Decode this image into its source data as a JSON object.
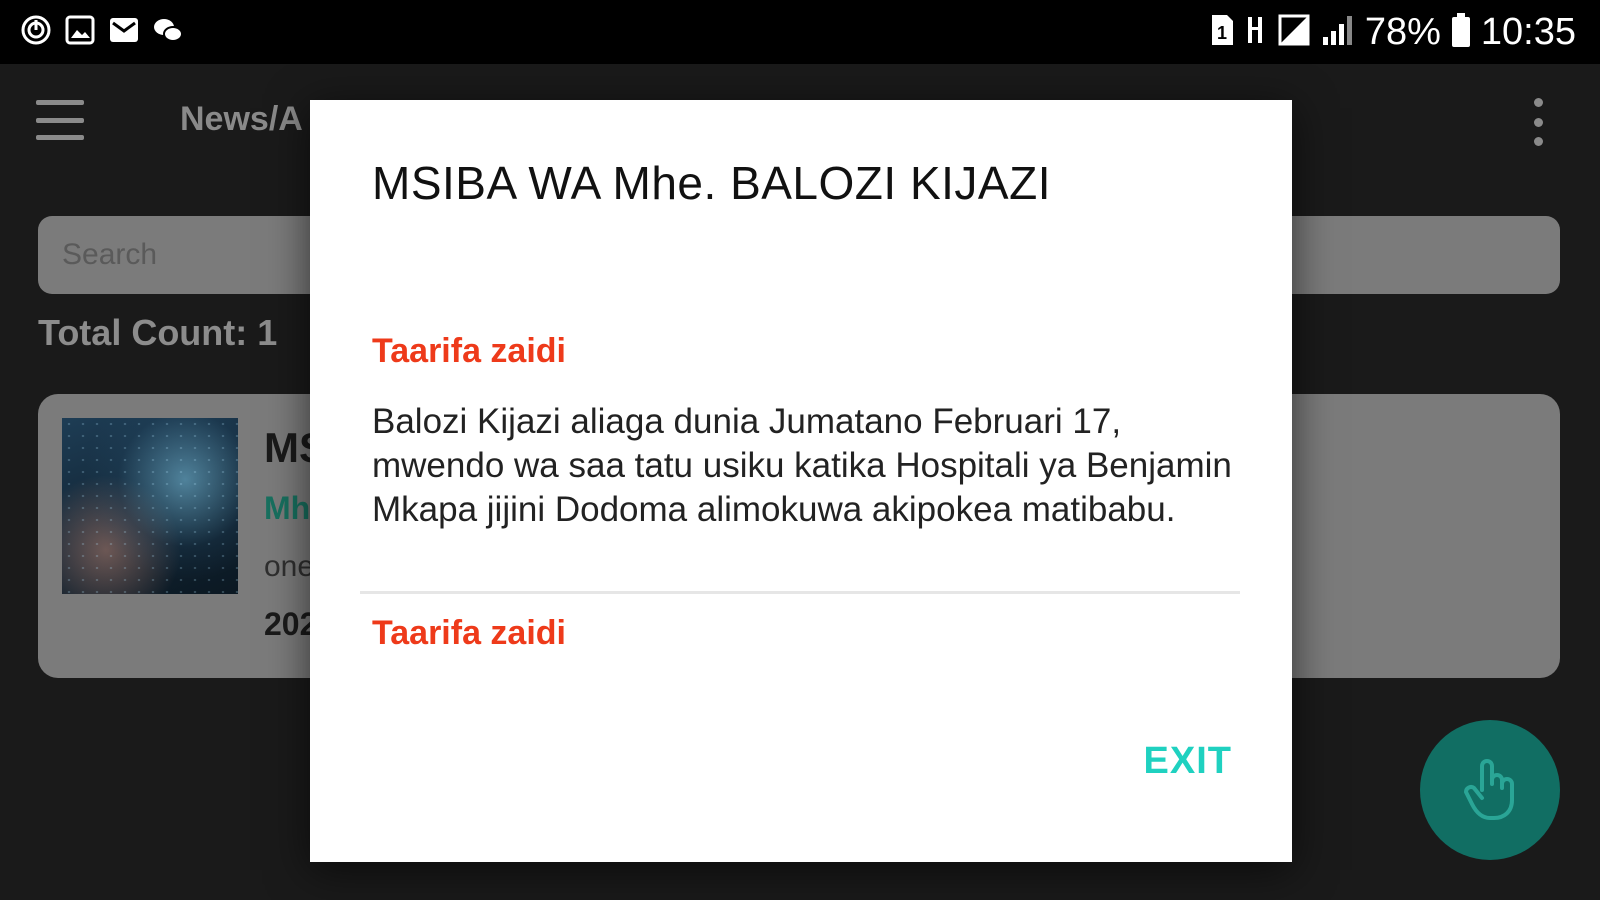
{
  "status_bar": {
    "battery_percent": "78%",
    "clock": "10:35",
    "left_icons": [
      "alarm-icon",
      "gallery-icon",
      "mail-icon",
      "chat-icon"
    ],
    "right_icons": [
      "sim-icon",
      "data-arrows-icon",
      "no-signal-icon",
      "signal-icon",
      "battery-icon"
    ]
  },
  "app_bar": {
    "title": "News/A",
    "menu_icon": "hamburger-menu-icon",
    "overflow_icon": "more-vert-icon"
  },
  "search": {
    "placeholder": "Search"
  },
  "list": {
    "total_count": "Total Count: 1",
    "items": [
      {
        "title": "MS",
        "subtitle": "Mh",
        "summary": "one",
        "date": "202"
      }
    ]
  },
  "fab": {
    "icon": "touch-hand-icon"
  },
  "dialog": {
    "title": "MSIBA WA Mhe. BALOZI KIJAZI",
    "link_top": "Taarifa zaidi",
    "body": "Balozi Kijazi aliaga dunia Jumatano Februari 17, mwendo wa saa tatu usiku katika Hospitali ya Benjamin Mkapa jijini Dodoma alimokuwa akipokea matibabu.",
    "link_bottom": "Taarifa zaidi",
    "exit_label": "EXIT"
  },
  "colors": {
    "accent_teal": "#1fd1c0",
    "link_red": "#ee3a1a",
    "fab_green": "#116e63"
  }
}
